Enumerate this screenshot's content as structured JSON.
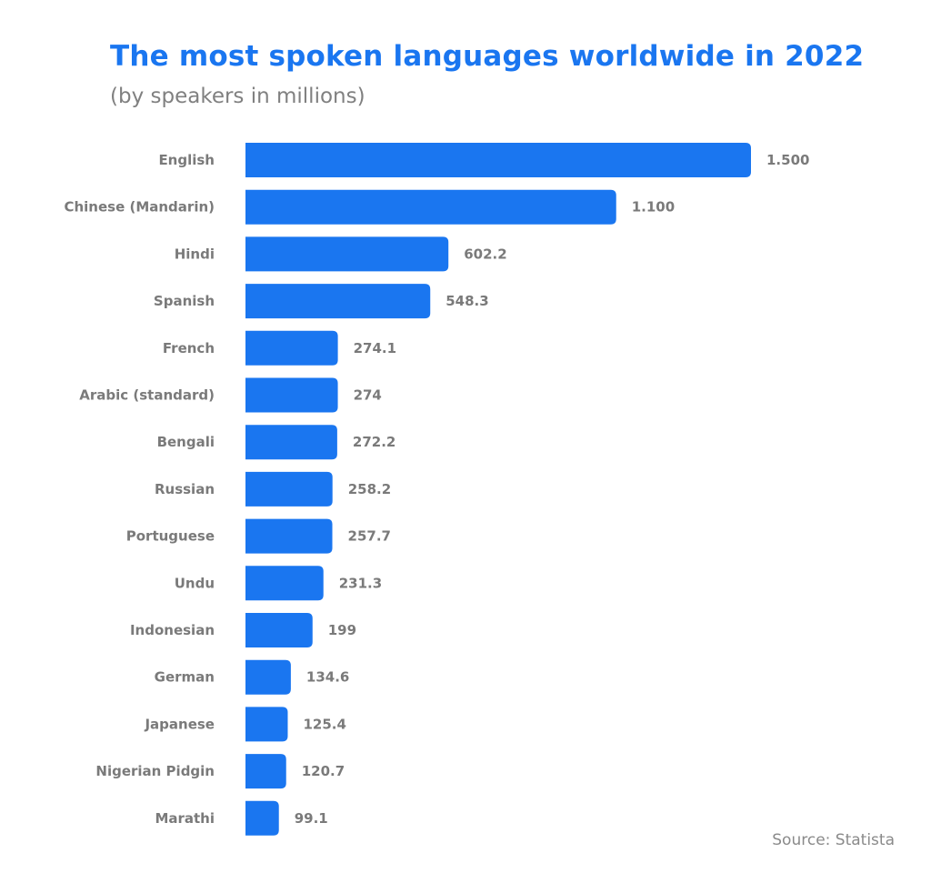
{
  "chart_data": {
    "type": "bar",
    "orientation": "horizontal",
    "title": "The most spoken languages worldwide in 2022",
    "subtitle": "(by speakers in millions)",
    "xlabel": "",
    "ylabel": "",
    "source": "Source: Statista",
    "color": "#1a76f0",
    "grid": false,
    "xlim": [
      0,
      1500
    ],
    "categories": [
      "English",
      "Chinese (Mandarin)",
      "Hindi",
      "Spanish",
      "French",
      "Arabic (standard)",
      "Bengali",
      "Russian",
      "Portuguese",
      "Undu",
      "Indonesian",
      "German",
      "Japanese",
      "Nigerian Pidgin",
      "Marathi"
    ],
    "values": [
      1500,
      1100,
      602.2,
      548.3,
      274.1,
      274,
      272.2,
      258.2,
      257.7,
      231.3,
      199,
      134.6,
      125.4,
      120.7,
      99.1
    ],
    "value_labels": [
      "1.500",
      "1.100",
      "602.2",
      "548.3",
      "274.1",
      "274",
      "272.2",
      "258.2",
      "257.7",
      "231.3",
      "199",
      "134.6",
      "125.4",
      "120.7",
      "99.1"
    ]
  }
}
